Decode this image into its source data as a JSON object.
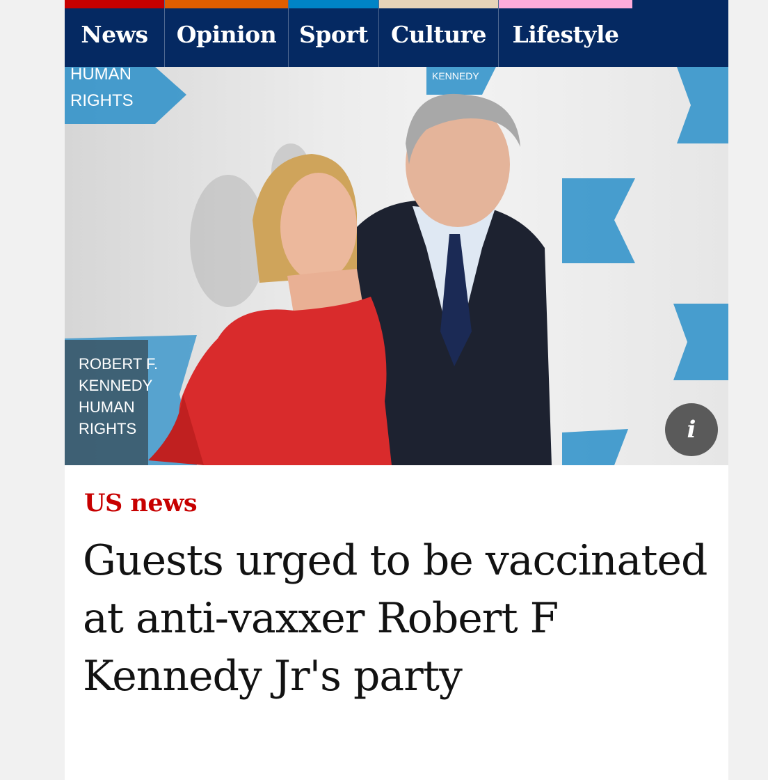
{
  "nav": {
    "items": [
      {
        "label": "News",
        "color": "#c70000"
      },
      {
        "label": "Opinion",
        "color": "#e05e00"
      },
      {
        "label": "Sport",
        "color": "#0084c6"
      },
      {
        "label": "Culture",
        "color": "#a1845c"
      },
      {
        "label": "Lifestyle",
        "color": "#ffabdb"
      }
    ],
    "background": "#052962"
  },
  "hero": {
    "backdrop_text": [
      "HUMAN",
      "RIGHTS",
      "KENNEDY",
      "ROBERT F.",
      "KENNEDY",
      "HUMAN",
      "RIGHTS"
    ],
    "info_icon": "info-icon",
    "info_label": "i"
  },
  "article": {
    "section": "US news",
    "section_color": "#c70000",
    "headline": "Guests urged to be vaccinated at anti-vaxxer Robert F Kennedy Jr's party"
  }
}
